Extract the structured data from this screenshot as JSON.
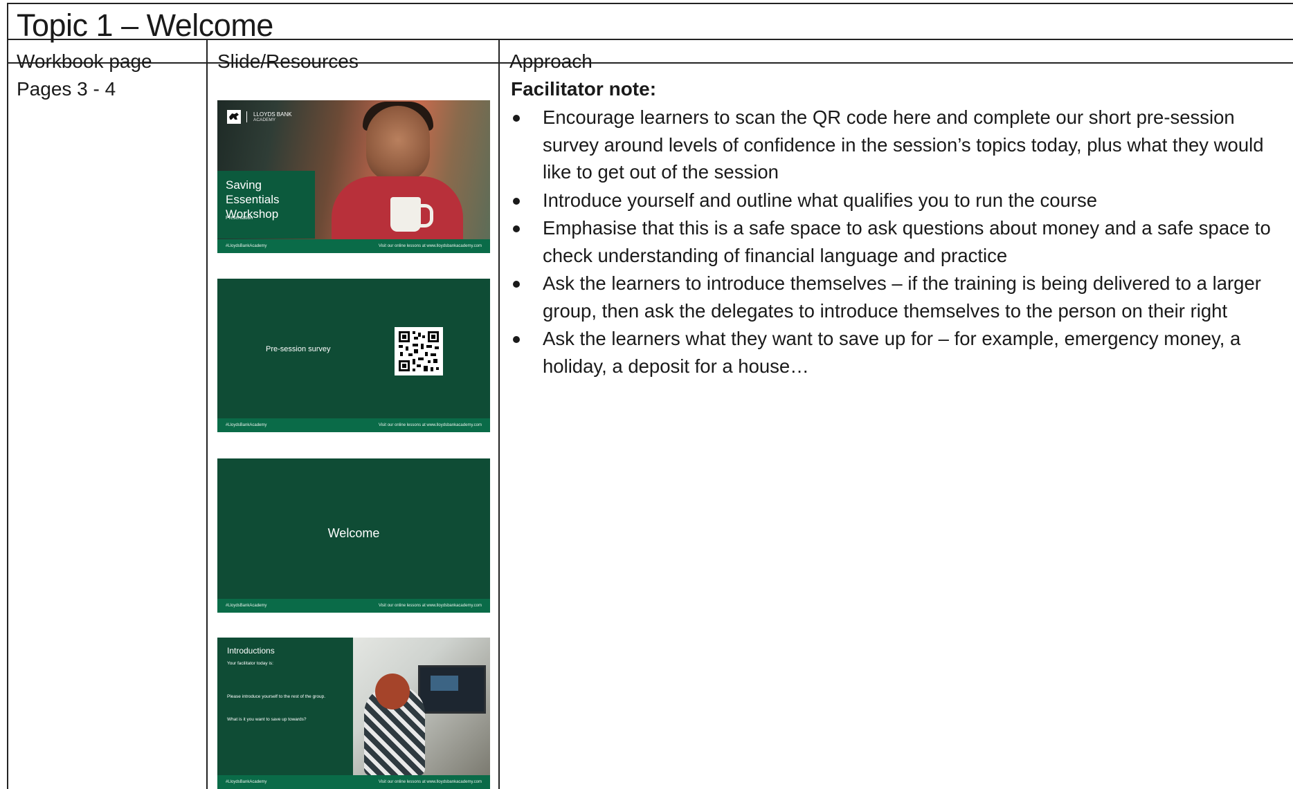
{
  "title": "Topic 1 – Welcome",
  "table": {
    "headers": [
      "Workbook page",
      "Slide/Resources",
      "Approach"
    ],
    "pages": "Pages 3 - 4"
  },
  "approach": {
    "note_title": "Facilitator note:",
    "bullets": [
      "Encourage learners to scan the QR code here and complete our short pre-session survey around levels of confidence in the session’s topics today, plus what they would like to get out of the session",
      "Introduce yourself and outline what qualifies you to run the course",
      "Emphasise that this is a safe space to ask questions about money and a safe space to check understanding of financial language and practice",
      "Ask the learners to introduce themselves – if the training is being delivered to a larger group, then ask the delegates to introduce themselves to the person on their right",
      "Ask the learners what they want to save up for –  for example, emergency money, a holiday, a deposit for a house…"
    ]
  },
  "slides": {
    "footer_left": "#LloydsBankAcademy",
    "footer_right": "Visit our online lessons at www.lloydsbankacademy.com",
    "slide1": {
      "logo": "LLOYDS BANK",
      "logo_sub": "ACADEMY",
      "title": "Saving Essentials Workshop",
      "label": "Presentation"
    },
    "slide2": {
      "label": "Pre-session survey",
      "icon": "qr-code-icon"
    },
    "slide3": {
      "label": "Welcome"
    },
    "slide4": {
      "title": "Introductions",
      "line1": "Your facilitator today is:",
      "line2": "Please introduce yourself to the rest of the group.",
      "line3": "What is it you want to save up towards?"
    }
  },
  "colors": {
    "slide_green": "#0f4c35",
    "footer_green": "#0a6b48"
  }
}
